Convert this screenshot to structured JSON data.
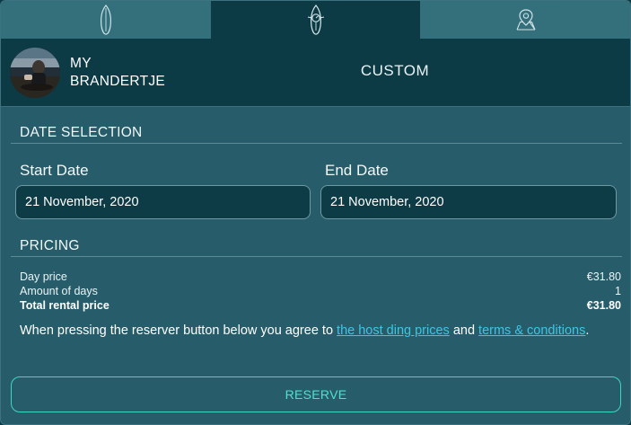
{
  "tabs": [
    {
      "icon": "surfboard-icon",
      "active": false
    },
    {
      "icon": "surfer-wetsuit-icon",
      "active": true
    },
    {
      "icon": "map-pin-icon",
      "active": false
    }
  ],
  "header": {
    "brand_name": "MY\nBRANDERTJE",
    "mode": "CUSTOM"
  },
  "date_selection": {
    "title": "DATE SELECTION",
    "start_label": "Start Date",
    "start_value": "21 November, 2020",
    "end_label": "End Date",
    "end_value": "21 November, 2020"
  },
  "pricing": {
    "title": "PRICING",
    "rows": [
      {
        "label": "Day price",
        "value": "€31.80"
      },
      {
        "label": "Amount of days",
        "value": "1"
      },
      {
        "label": "Total rental price",
        "value": "€31.80"
      }
    ],
    "terms_prefix": "When pressing the reserver button below you agree to ",
    "terms_link1": "the host ding prices",
    "terms_middle": " and ",
    "terms_link2": "terms & conditions",
    "terms_suffix": "."
  },
  "reserve_label": "RESERVE",
  "colors": {
    "accent": "#3fd6c2",
    "link": "#3ec4e8",
    "panel": "#275d6a",
    "dark": "#0c3a45"
  }
}
